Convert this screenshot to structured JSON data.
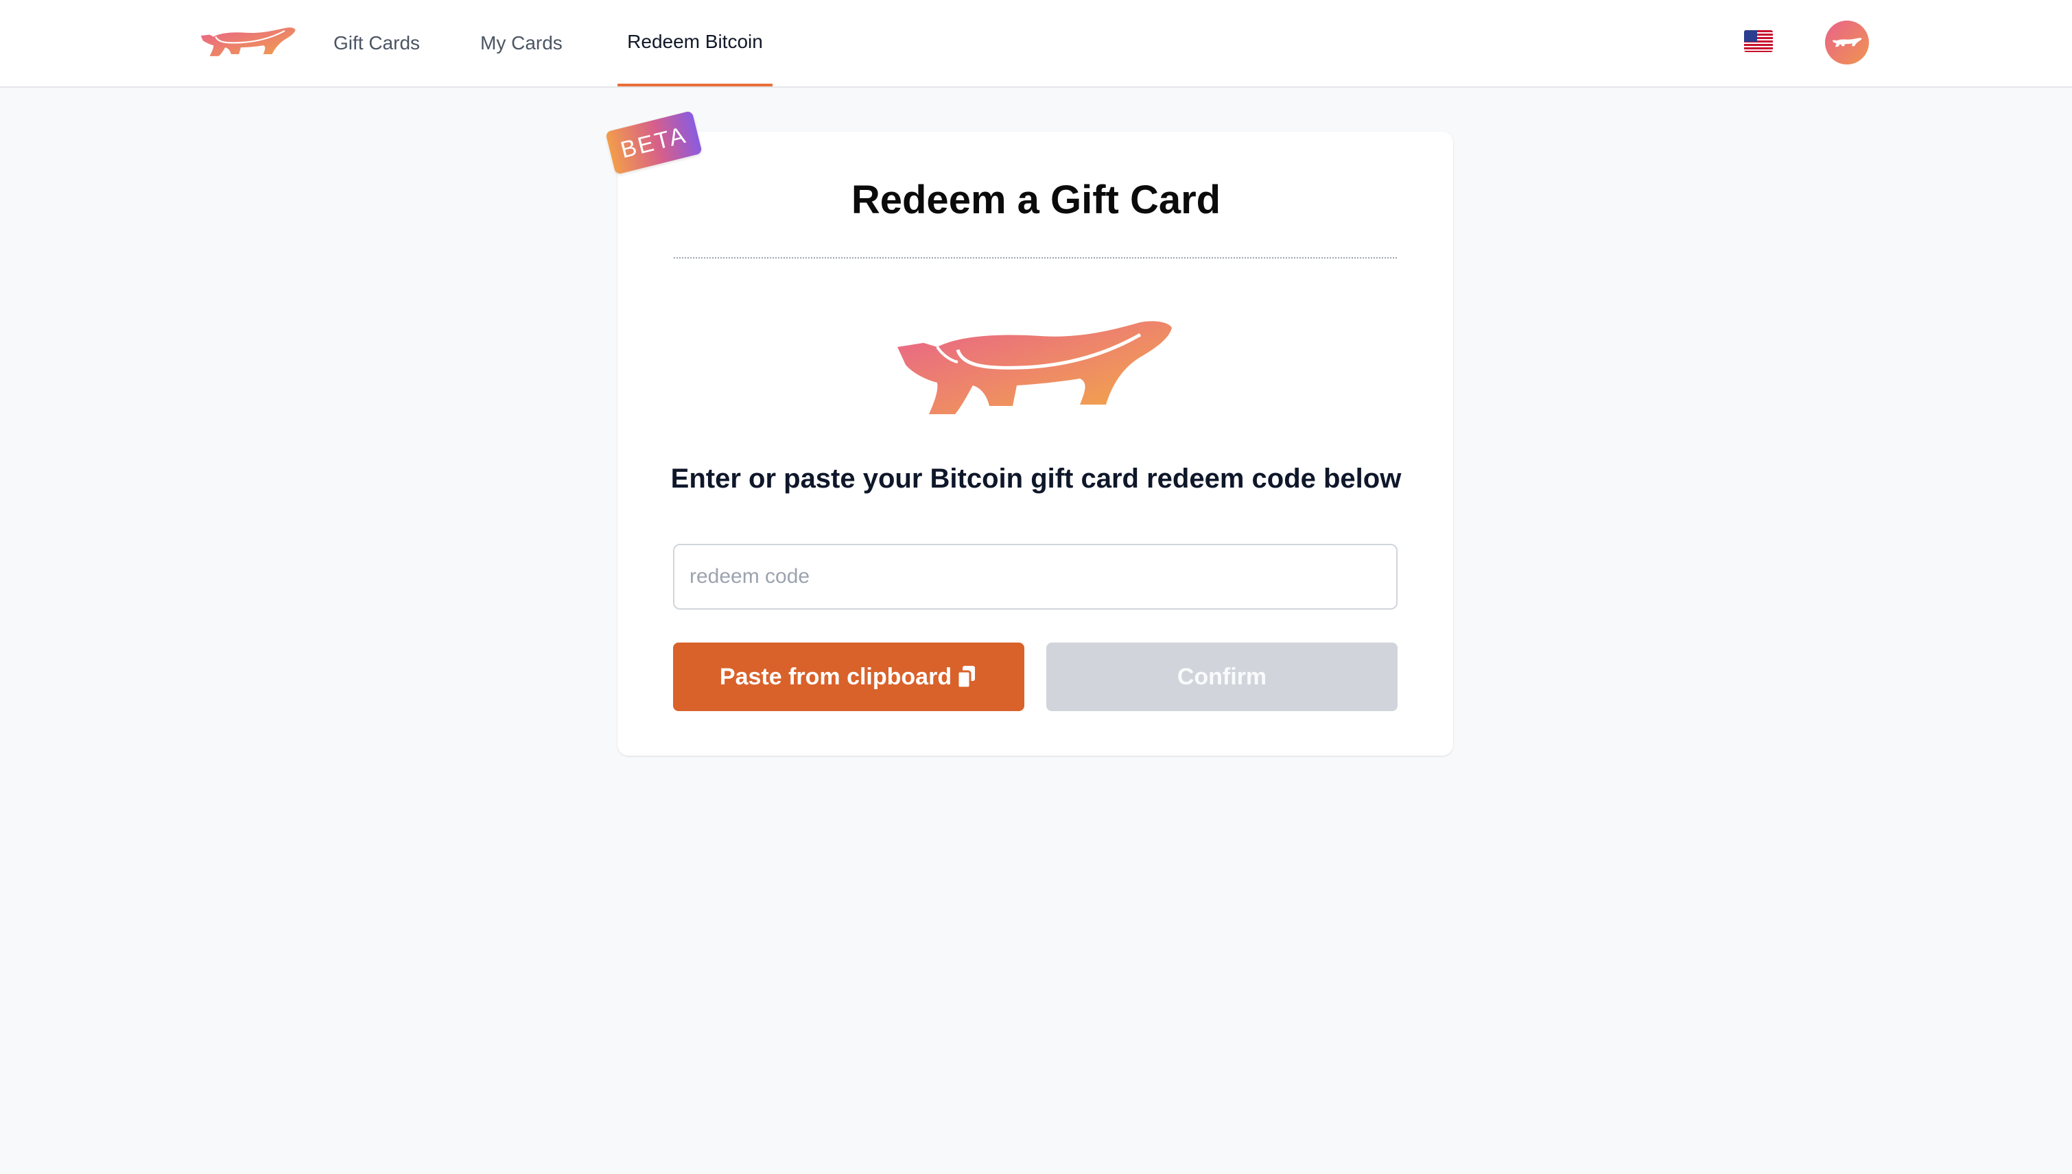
{
  "nav": {
    "tabs": [
      {
        "label": "Gift Cards",
        "active": false
      },
      {
        "label": "My Cards",
        "active": false
      },
      {
        "label": "Redeem Bitcoin",
        "active": true
      }
    ],
    "logo_icon": "honey-badger-logo-icon",
    "language_icon": "us-flag-icon",
    "avatar_icon": "honey-badger-avatar-icon",
    "accent_color": "#e8703a"
  },
  "card": {
    "badge": "BETA",
    "title": "Redeem a Gift Card",
    "mascot_icon": "honey-badger-icon",
    "instruction": "Enter or paste your Bitcoin gift card redeem code below",
    "input": {
      "placeholder": "redeem code",
      "value": ""
    },
    "paste_button": {
      "label": "Paste from clipboard",
      "icon": "clipboard-icon",
      "color": "#d9622b"
    },
    "confirm_button": {
      "label": "Confirm",
      "disabled": true,
      "color": "#d1d5db"
    }
  }
}
